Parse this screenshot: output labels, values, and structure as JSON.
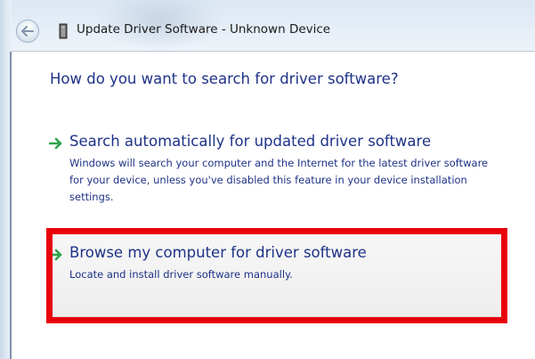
{
  "window": {
    "title": "Update Driver Software - Unknown Device"
  },
  "icons": {
    "back": "back-arrow-icon",
    "device": "device-icon",
    "option_arrow": "green-arrow-icon"
  },
  "main": {
    "heading": "How do you want to search for driver software?",
    "options": [
      {
        "title": "Search automatically for updated driver software",
        "description": "Windows will search your computer and the Internet for the latest driver software for your device, unless you've disabled this feature in your device installation settings."
      },
      {
        "title": "Browse my computer for driver software",
        "description": "Locate and install driver software manually."
      }
    ]
  },
  "colors": {
    "text_blue": "#1e3287",
    "arrow_green": "#2ea44a",
    "highlight_red": "#e8000b"
  }
}
